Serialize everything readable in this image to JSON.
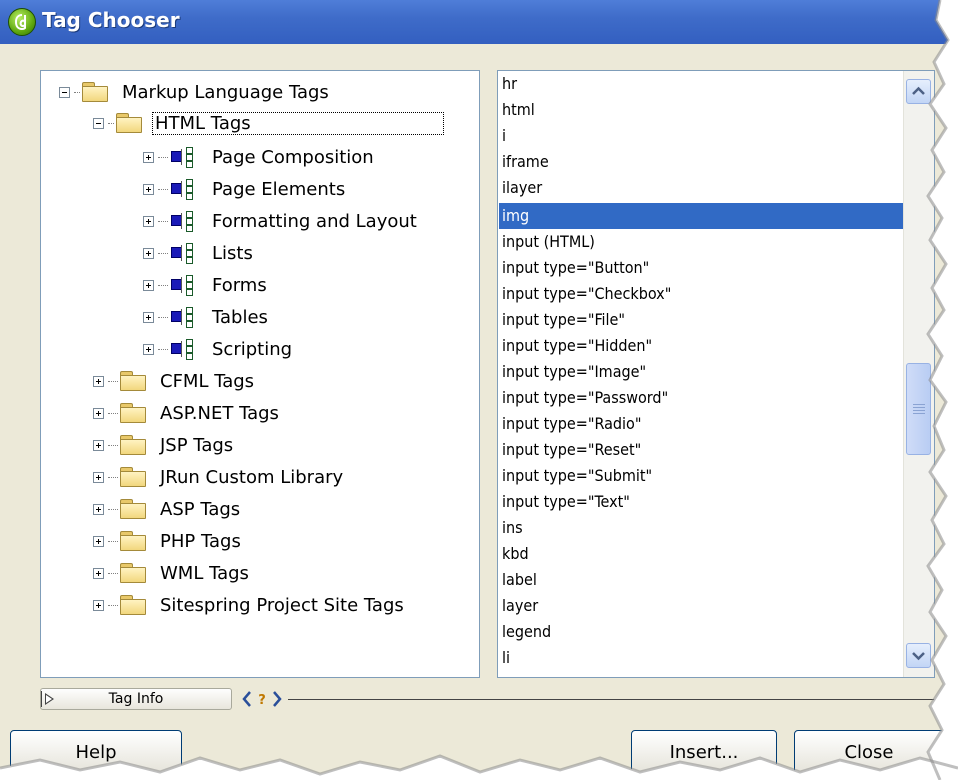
{
  "window": {
    "title": "Tag Chooser"
  },
  "tree": {
    "root": {
      "label": "Markup Language Tags"
    },
    "html_tags": {
      "label": "HTML Tags",
      "children": [
        {
          "label": "Page Composition"
        },
        {
          "label": "Page Elements"
        },
        {
          "label": "Formatting and Layout"
        },
        {
          "label": "Lists"
        },
        {
          "label": "Forms"
        },
        {
          "label": "Tables"
        },
        {
          "label": "Scripting"
        }
      ]
    },
    "folders": [
      {
        "label": "CFML Tags"
      },
      {
        "label": "ASP.NET Tags"
      },
      {
        "label": "JSP Tags"
      },
      {
        "label": "JRun Custom Library"
      },
      {
        "label": "ASP Tags"
      },
      {
        "label": "PHP Tags"
      },
      {
        "label": "WML Tags"
      },
      {
        "label": "Sitespring Project Site Tags"
      }
    ]
  },
  "tag_list": {
    "selected_index": 5,
    "items": [
      "hr",
      "html",
      "i",
      "iframe",
      "ilayer",
      "img",
      "input (HTML)",
      "input type=\"Button\"",
      "input type=\"Checkbox\"",
      "input type=\"File\"",
      "input type=\"Hidden\"",
      "input type=\"Image\"",
      "input type=\"Password\"",
      "input type=\"Radio\"",
      "input type=\"Reset\"",
      "input type=\"Submit\"",
      "input type=\"Text\"",
      "ins",
      "kbd",
      "label",
      "layer",
      "legend",
      "li"
    ]
  },
  "tag_info": {
    "button_label": "Tag Info",
    "reference_icon": "reference-icon"
  },
  "buttons": {
    "help": "Help",
    "insert": "Insert...",
    "close": "Close"
  },
  "colors": {
    "titlebar": "#3f6cc9",
    "selection": "#316ac5",
    "pane_border": "#7f9db9",
    "dialog_bg": "#ece9d8"
  }
}
